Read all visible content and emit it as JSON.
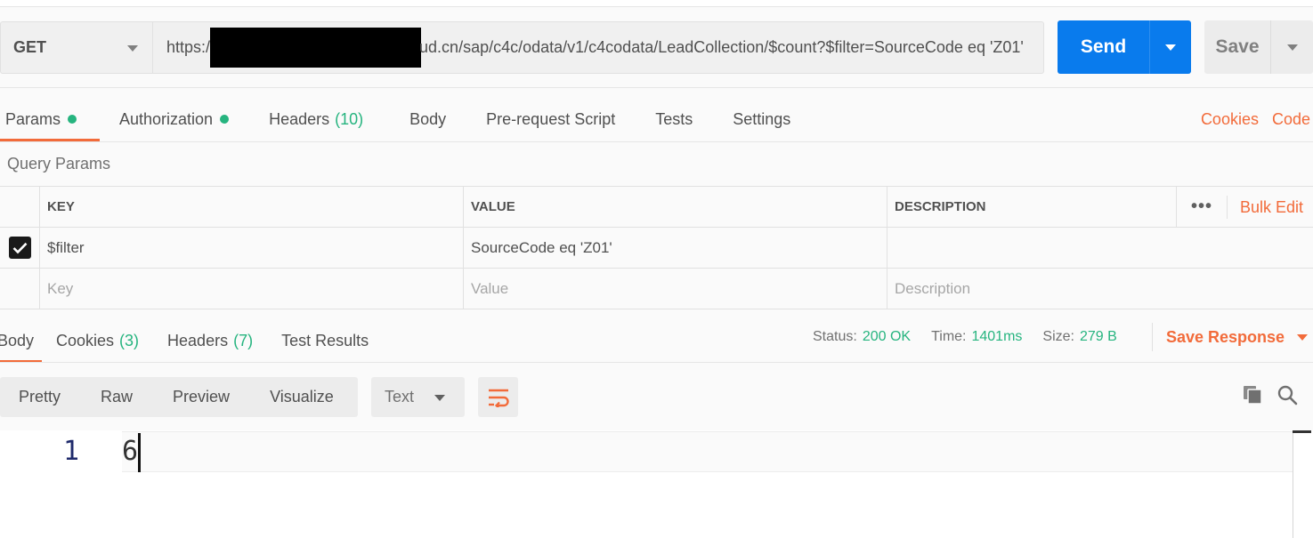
{
  "request": {
    "method": "GET",
    "url_prefix": "https:/",
    "url_rest": "ud.cn/sap/c4c/odata/v1/c4codata/LeadCollection/$count?$filter=SourceCode eq 'Z01'",
    "send_label": "Send",
    "save_label": "Save"
  },
  "request_tabs": [
    {
      "label": "Params",
      "dot": true,
      "active": true
    },
    {
      "label": "Authorization",
      "dot": true
    },
    {
      "label": "Headers",
      "count": "(10)"
    },
    {
      "label": "Body"
    },
    {
      "label": "Pre-request Script"
    },
    {
      "label": "Tests"
    },
    {
      "label": "Settings"
    }
  ],
  "request_links": {
    "cookies": "Cookies",
    "code": "Code"
  },
  "query_params": {
    "title": "Query Params",
    "headers": {
      "key": "KEY",
      "value": "VALUE",
      "description": "DESCRIPTION"
    },
    "more": "•••",
    "bulk_edit": "Bulk Edit",
    "rows": [
      {
        "checked": true,
        "key": "$filter",
        "value": "SourceCode eq 'Z01'",
        "description": ""
      }
    ],
    "placeholders": {
      "key": "Key",
      "value": "Value",
      "description": "Description"
    }
  },
  "response_tabs": [
    {
      "label": "Body",
      "active": true
    },
    {
      "label": "Cookies",
      "count": "(3)"
    },
    {
      "label": "Headers",
      "count": "(7)"
    },
    {
      "label": "Test Results"
    }
  ],
  "response_status": {
    "status_label": "Status:",
    "status_value": "200 OK",
    "time_label": "Time:",
    "time_value": "1401ms",
    "size_label": "Size:",
    "size_value": "279 B",
    "save_response": "Save Response"
  },
  "view_modes": [
    "Pretty",
    "Raw",
    "Preview",
    "Visualize"
  ],
  "format": "Text",
  "body": {
    "line_number": "1",
    "content": "6"
  },
  "colors": {
    "accent": "#f26b3a",
    "send": "#097bed",
    "success": "#26b47f"
  }
}
